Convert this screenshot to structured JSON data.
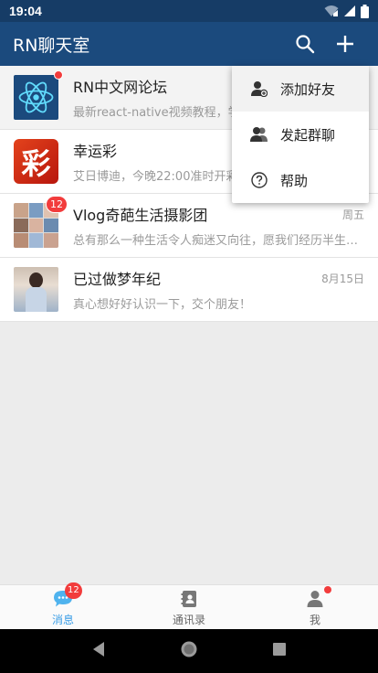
{
  "status_bar": {
    "time": "19:04"
  },
  "app_bar": {
    "title": "RN聊天室"
  },
  "chats": [
    {
      "name": "RN中文网论坛",
      "preview": "最新react-native视频教程，学完就能写出RN项目",
      "time": "",
      "badge": "",
      "dot": true,
      "active": true
    },
    {
      "name": "幸运彩",
      "preview": "艾日博迪，今晚22:00准时开彩",
      "time": "",
      "badge": "",
      "dot": false,
      "active": false
    },
    {
      "name": "Vlog奇葩生活摄影团",
      "preview": "总有那么一种生活令人痴迷又向往，愿我们经历半生，归来仍是少年",
      "time": "周五",
      "badge": "12",
      "dot": false,
      "active": false
    },
    {
      "name": "已过做梦年纪",
      "preview": "真心想好好认识一下，交个朋友！",
      "time": "8月15日",
      "badge": "",
      "dot": false,
      "active": false
    }
  ],
  "popup_menu": {
    "items": [
      {
        "label": "添加好友",
        "icon": "add-person-icon"
      },
      {
        "label": "发起群聊",
        "icon": "group-icon"
      },
      {
        "label": "帮助",
        "icon": "help-icon"
      }
    ]
  },
  "avatar_text": {
    "lottery": "彩"
  },
  "tabs": [
    {
      "label": "消息",
      "icon": "chat-bubble-icon",
      "badge": "12",
      "active": true
    },
    {
      "label": "通讯录",
      "icon": "contacts-icon",
      "badge": "",
      "active": false
    },
    {
      "label": "我",
      "icon": "person-icon",
      "badge": "",
      "active": false,
      "dot": true
    }
  ],
  "colors": {
    "header": "#1b4a7d",
    "status_bar": "#163c66",
    "accent": "#3a9de6",
    "badge": "#f23c3c"
  }
}
